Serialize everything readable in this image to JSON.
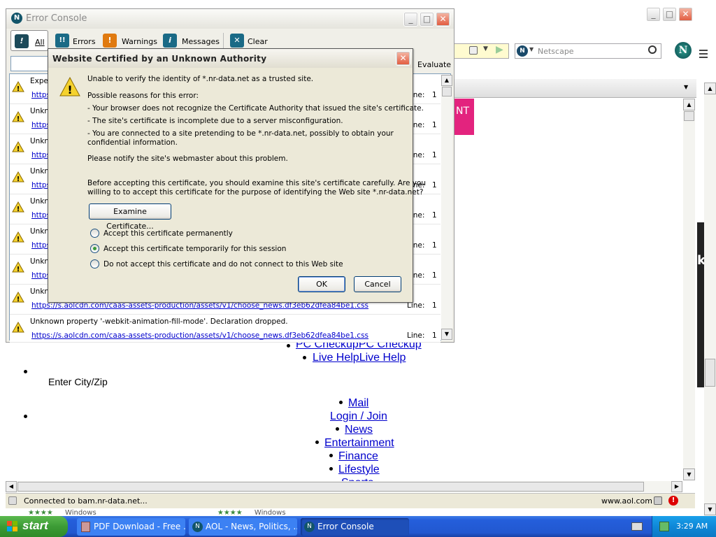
{
  "browser": {
    "search_placeholder": "Netscape",
    "status_text": "Connected to bam.nr-data.net...",
    "status_url": "www.aol.com",
    "pink_text": "NT",
    "side_letter": "k",
    "page_links": {
      "pc_checkup": "PC CheckupPC Checkup",
      "live_help": "Live HelpLive Help",
      "enter_city": "Enter City/Zip",
      "mail": "Mail",
      "login": "Login / Join",
      "news": "News",
      "entertainment": "Entertainment",
      "finance": "Finance",
      "lifestyle": "Lifestyle",
      "sports": "Sports"
    },
    "windows_text": "Windows"
  },
  "console": {
    "title": "Error Console",
    "tabs": [
      {
        "label": "All"
      },
      {
        "label": "Errors"
      },
      {
        "label": "Warnings"
      },
      {
        "label": "Messages"
      },
      {
        "label": "Clear"
      }
    ],
    "evaluate_label": "Evaluate",
    "line_label": "Line:",
    "rows": [
      {
        "msg": "Expe",
        "src": "https",
        "line": "1"
      },
      {
        "msg": "Unkn",
        "src": "https",
        "line": "1"
      },
      {
        "msg": "Unkn",
        "src": "https",
        "line": "1"
      },
      {
        "msg": "Unkn",
        "src": "https",
        "line": "1"
      },
      {
        "msg": "Unkn",
        "src": "https",
        "line": "1"
      },
      {
        "msg": "Unkn",
        "src": "https",
        "line": "1"
      },
      {
        "msg": "Unkn",
        "src": "https",
        "line": "1"
      },
      {
        "msg": "Unkn",
        "src": "https://s.aolcdn.com/caas-assets-production/assets/v1/choose_news.df3eb62dfea84be1.css",
        "line": "1"
      },
      {
        "msg": "Unknown property '-webkit-animation-fill-mode'. Declaration dropped.",
        "src": "https://s.aolcdn.com/caas-assets-production/assets/v1/choose_news.df3eb62dfea84be1.css",
        "line": "1"
      }
    ]
  },
  "dialog": {
    "title": "Website Certified by an Unknown Authority",
    "intro": "Unable to verify the identity of *.nr-data.net as a trusted site.",
    "reasons_heading": "Possible reasons for this error:",
    "reason1": "- Your browser does not recognize the Certificate Authority that issued the site's certificate.",
    "reason2": "- The site's certificate is incomplete due to a server misconfiguration.",
    "reason3a": "- You are connected to a site pretending to be *.nr-data.net, possibly to obtain your",
    "reason3b": "confidential information.",
    "notify": "Please notify the site's webmaster about this problem.",
    "examine_a": "Before accepting this certificate, you should examine this site's certificate carefully. Are you",
    "examine_b": "willing to to accept this certificate for the purpose of identifying the Web site *.nr-data.net?",
    "examine_button": "Examine Certificate...",
    "options": [
      {
        "label": "Accept this certificate permanently",
        "selected": false
      },
      {
        "label": "Accept this certificate temporarily for this session",
        "selected": true
      },
      {
        "label": "Do not accept this certificate and do not connect to this Web site",
        "selected": false
      }
    ],
    "ok_label": "OK",
    "cancel_label": "Cancel"
  },
  "taskbar": {
    "start_label": "start",
    "tasks": [
      {
        "label": "PDF Download - Free ..."
      },
      {
        "label": "AOL - News, Politics, ..."
      },
      {
        "label": "Error Console"
      }
    ],
    "clock": "3:29 AM"
  },
  "colors": {
    "xp_blue": "#245edb",
    "start_green": "#3c9b35",
    "pink": "#e3237e",
    "dialog_title": "#ece9d8"
  }
}
